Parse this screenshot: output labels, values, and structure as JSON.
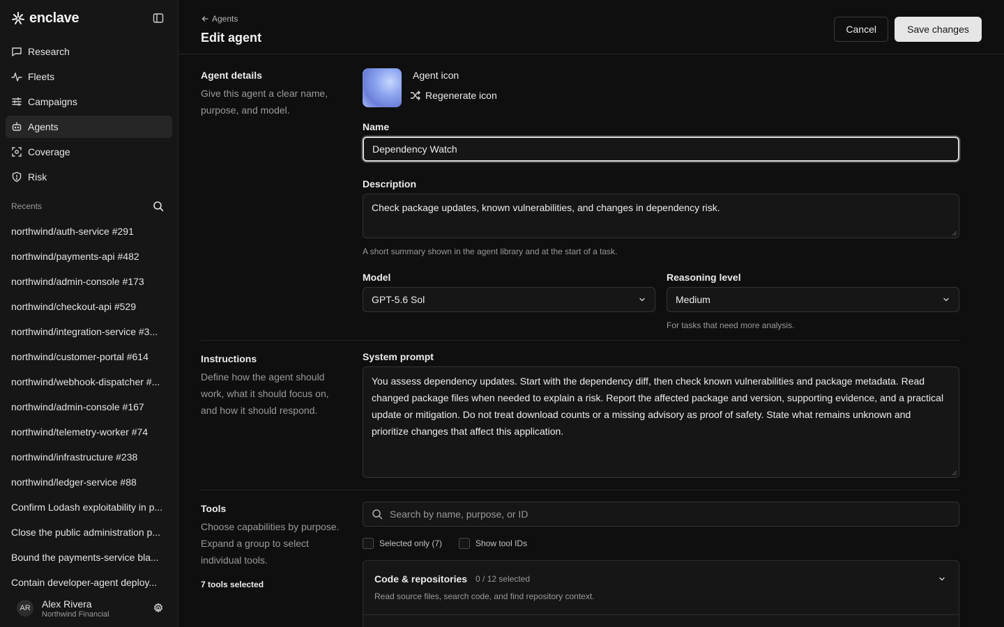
{
  "brand": {
    "name": "enclave"
  },
  "nav": [
    {
      "label": "Research",
      "icon": "chat-icon"
    },
    {
      "label": "Fleets",
      "icon": "activity-icon"
    },
    {
      "label": "Campaigns",
      "icon": "sliders-icon"
    },
    {
      "label": "Agents",
      "icon": "bot-icon",
      "active": true
    },
    {
      "label": "Coverage",
      "icon": "scan-icon"
    },
    {
      "label": "Risk",
      "icon": "shield-icon"
    }
  ],
  "recents": {
    "title": "Recents",
    "items": [
      "northwind/auth-service #291",
      "northwind/payments-api #482",
      "northwind/admin-console #173",
      "northwind/checkout-api #529",
      "northwind/integration-service #3...",
      "northwind/customer-portal #614",
      "northwind/webhook-dispatcher #...",
      "northwind/admin-console #167",
      "northwind/telemetry-worker #74",
      "northwind/infrastructure #238",
      "northwind/ledger-service #88",
      "Confirm Lodash exploitability in p...",
      "Close the public administration p...",
      "Bound the payments-service bla...",
      "Contain developer-agent deploy..."
    ]
  },
  "user": {
    "initials": "AR",
    "name": "Alex Rivera",
    "org": "Northwind Financial"
  },
  "header": {
    "back_label": "Agents",
    "title": "Edit agent",
    "cancel_label": "Cancel",
    "save_label": "Save changes"
  },
  "details": {
    "title": "Agent details",
    "desc": "Give this agent a clear name, purpose, and model.",
    "icon_label": "Agent icon",
    "regenerate_label": "Regenerate icon",
    "name_label": "Name",
    "name_value": "Dependency Watch",
    "description_label": "Description",
    "description_value": "Check package updates, known vulnerabilities, and changes in dependency risk.",
    "description_hint": "A short summary shown in the agent library and at the start of a task.",
    "model_label": "Model",
    "model_value": "GPT-5.6 Sol",
    "reasoning_label": "Reasoning level",
    "reasoning_value": "Medium",
    "reasoning_hint": "For tasks that need more analysis."
  },
  "instructions": {
    "title": "Instructions",
    "desc": "Define how the agent should work, what it should focus on, and how it should respond.",
    "prompt_label": "System prompt",
    "prompt_value": "You assess dependency updates. Start with the dependency diff, then check known vulnerabilities and package metadata. Read changed package files when needed to explain a risk. Report the affected package and version, supporting evidence, and a practical update or mitigation. Do not treat download counts or a missing advisory as proof of safety. State what remains unknown and prioritize changes that affect this application."
  },
  "tools": {
    "title": "Tools",
    "desc": "Choose capabilities by purpose. Expand a group to select individual tools.",
    "selected_count": "7 tools selected",
    "search_placeholder": "Search by name, purpose, or ID",
    "selected_only_label": "Selected only (7)",
    "show_ids_label": "Show tool IDs",
    "group_name": "Code & repositories",
    "group_count": "0 / 12 selected",
    "group_desc": "Read source files, search code, and find repository context."
  }
}
